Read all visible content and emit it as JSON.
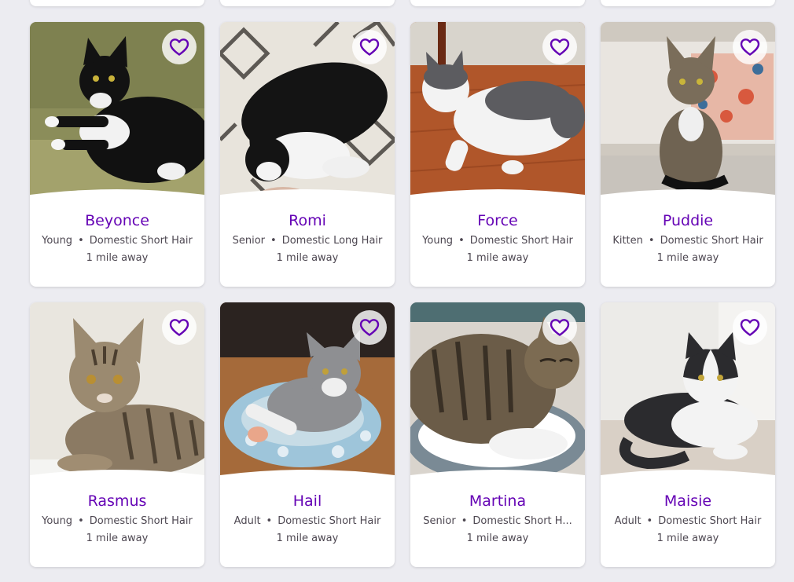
{
  "colors": {
    "background": "#ececf1",
    "card": "#ffffff",
    "name": "#6504b5",
    "meta_text": "#4d4751",
    "heart": "#6504b5"
  },
  "separator": "•",
  "pets": [
    {
      "name": "Beyonce",
      "age": "Young",
      "breed": "Domestic Short Hair",
      "distance": "1 mile away",
      "photo": "tuxedo-cat-on-green-couch"
    },
    {
      "name": "Romi",
      "age": "Senior",
      "breed": "Domestic Long Hair",
      "distance": "1 mile away",
      "photo": "long-hair-tuxedo-cat-on-rug"
    },
    {
      "name": "Force",
      "age": "Young",
      "breed": "Domestic Short Hair",
      "distance": "1 mile away",
      "photo": "grey-white-cat-on-wood-floor"
    },
    {
      "name": "Puddie",
      "age": "Kitten",
      "breed": "Domestic Short Hair",
      "distance": "1 mile away",
      "photo": "tabby-kitten-sitting"
    },
    {
      "name": "Rasmus",
      "age": "Young",
      "breed": "Domestic Short Hair",
      "distance": "1 mile away",
      "photo": "tabby-cat-lying"
    },
    {
      "name": "Hail",
      "age": "Adult",
      "breed": "Domestic Short Hair",
      "distance": "1 mile away",
      "photo": "grey-white-cat-in-blue-bed"
    },
    {
      "name": "Martina",
      "age": "Senior",
      "breed": "Domestic Short H...",
      "distance": "1 mile away",
      "photo": "tabby-cat-in-fluffy-bed"
    },
    {
      "name": "Maisie",
      "age": "Adult",
      "breed": "Domestic Short Hair",
      "distance": "1 mile away",
      "photo": "black-white-cat-on-blanket"
    }
  ]
}
